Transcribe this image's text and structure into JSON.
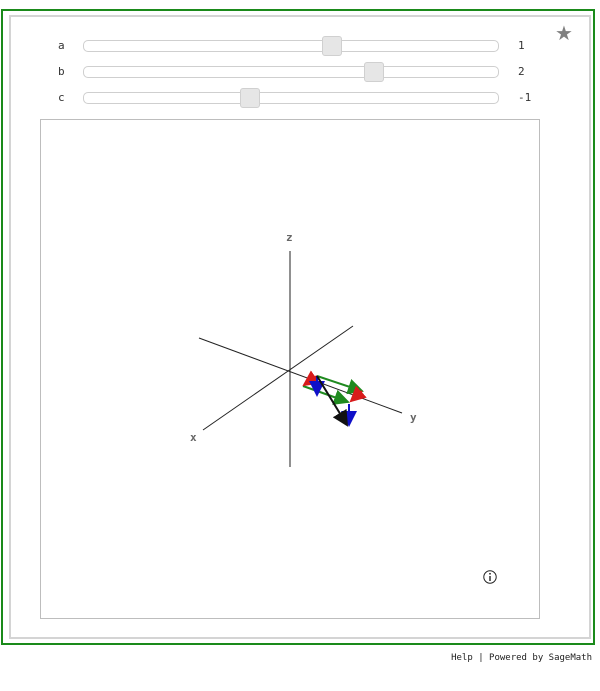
{
  "star_icon": "star-icon",
  "sliders": [
    {
      "label": "a",
      "value": "1",
      "position": 0.6
    },
    {
      "label": "b",
      "value": "2",
      "position": 0.7
    },
    {
      "label": "c",
      "value": "-1",
      "position": 0.4
    }
  ],
  "plot": {
    "axis_labels": {
      "x": "x",
      "y": "y",
      "z": "z"
    },
    "info_icon": "info-icon"
  },
  "footer": {
    "help": "Help",
    "separator": "|",
    "powered": "Powered by SageMath"
  }
}
